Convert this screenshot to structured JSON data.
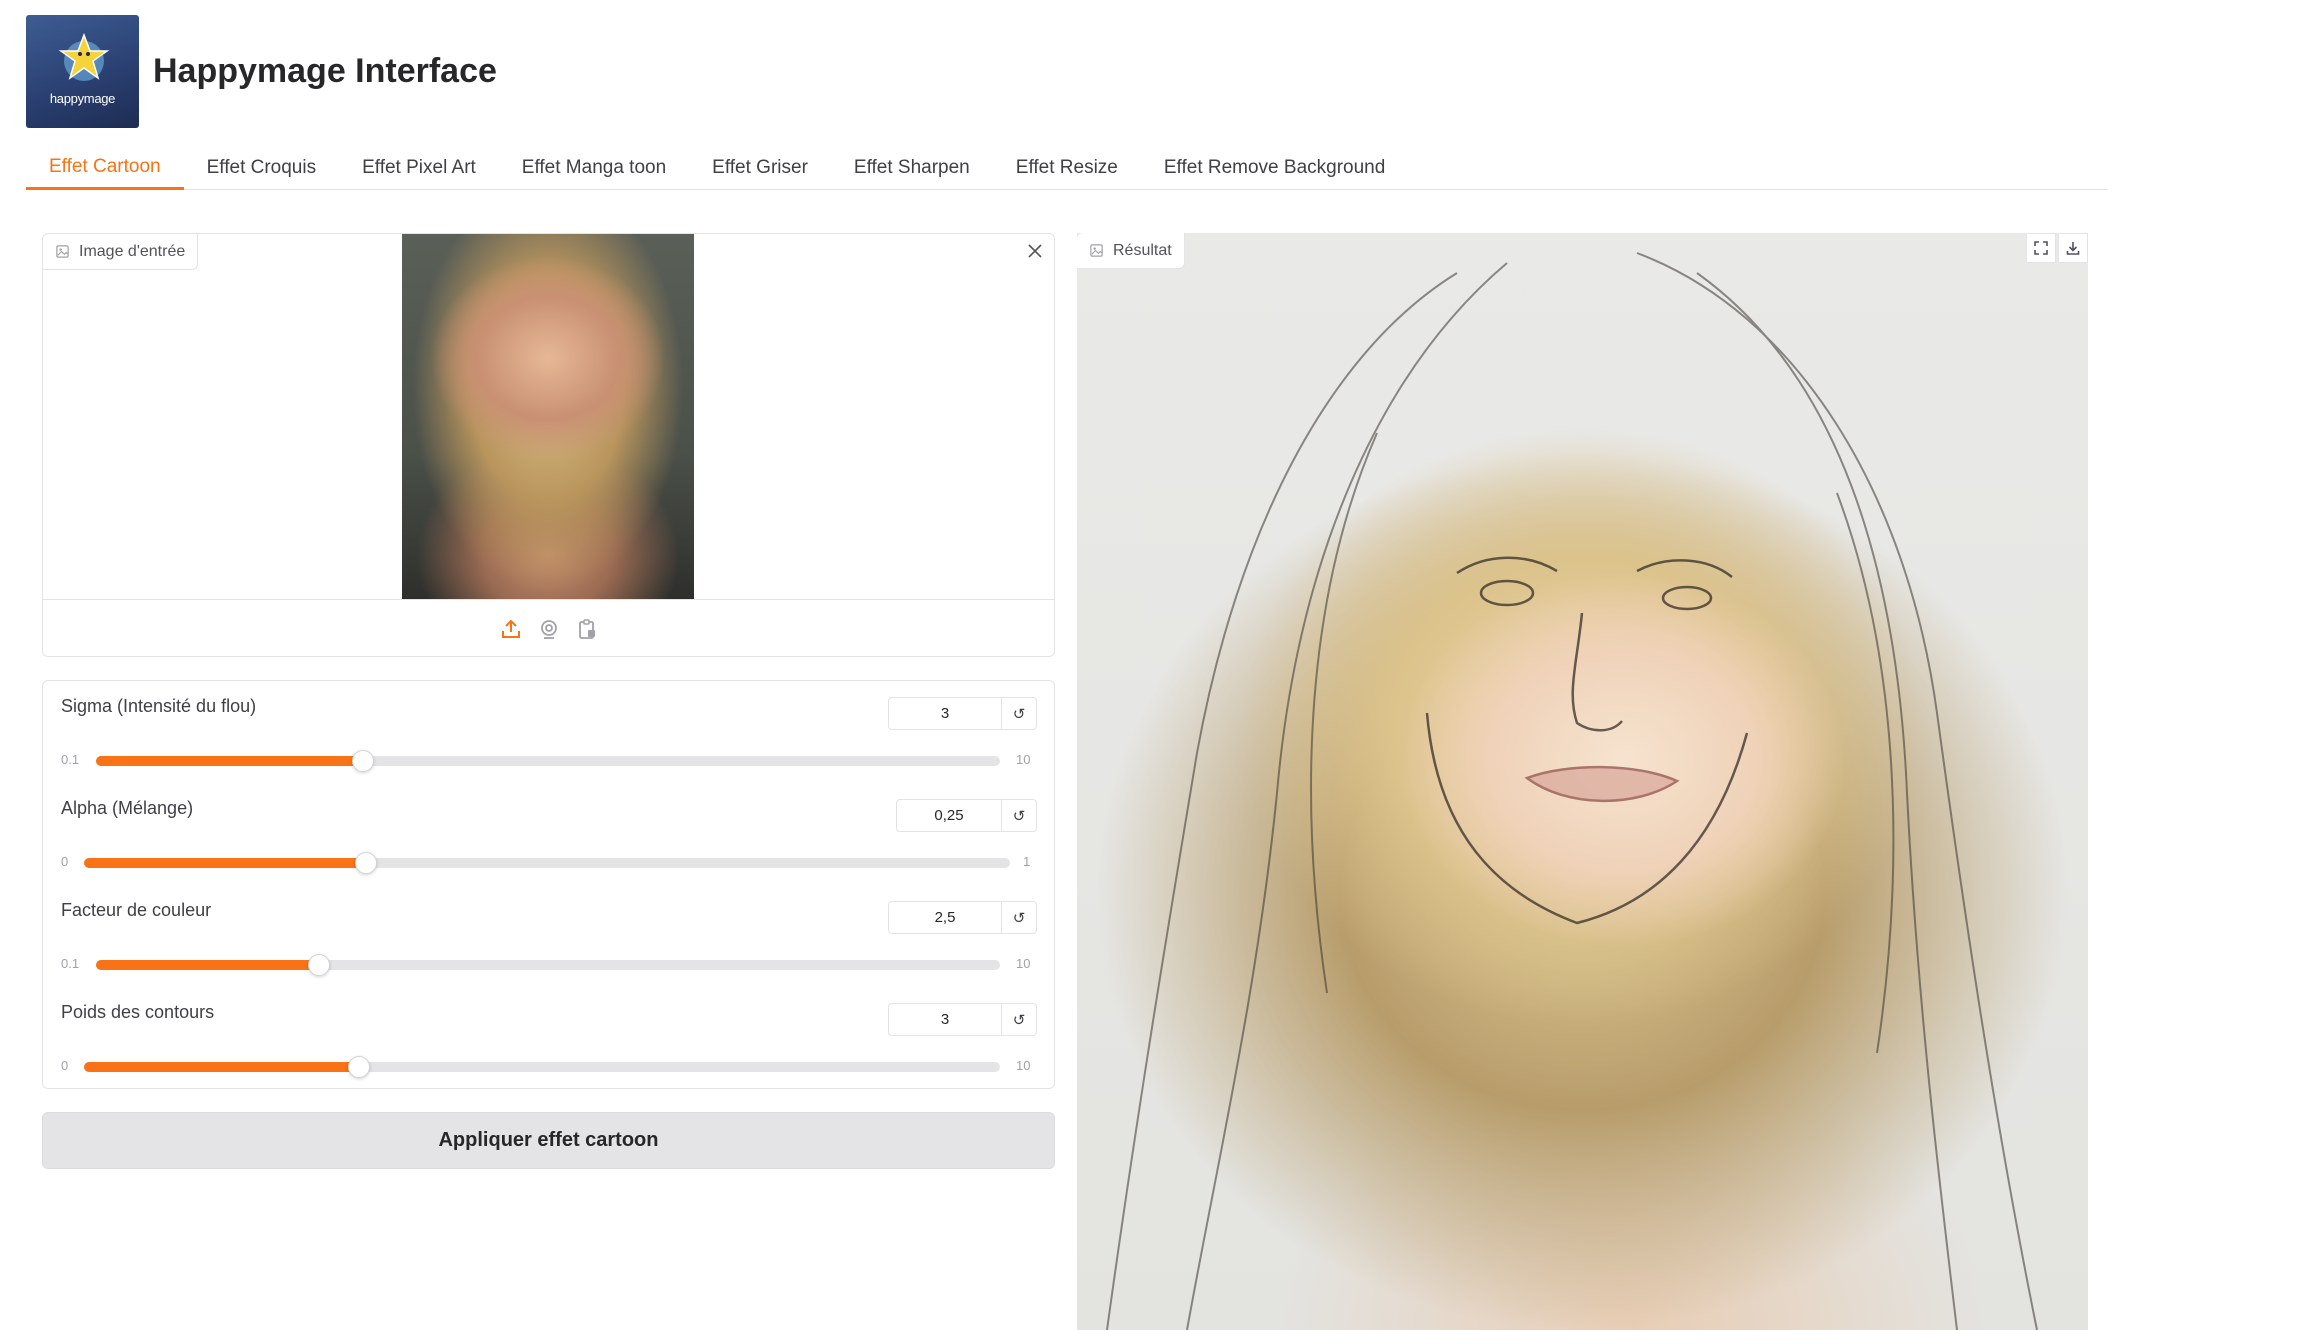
{
  "header": {
    "logo_text": "happymage",
    "title": "Happymage Interface"
  },
  "tabs": [
    {
      "label": "Effet Cartoon",
      "active": true
    },
    {
      "label": "Effet Croquis",
      "active": false
    },
    {
      "label": "Effet Pixel Art",
      "active": false
    },
    {
      "label": "Effet Manga toon",
      "active": false
    },
    {
      "label": "Effet Griser",
      "active": false
    },
    {
      "label": "Effet Sharpen",
      "active": false
    },
    {
      "label": "Effet Resize",
      "active": false
    },
    {
      "label": "Effet Remove Background",
      "active": false
    }
  ],
  "input_image": {
    "label": "Image d'entrée",
    "icons": [
      "image-icon",
      "close-icon",
      "upload-icon",
      "webcam-icon",
      "clipboard-icon"
    ]
  },
  "sliders": [
    {
      "label": "Sigma (Intensité du flou)",
      "value": "3",
      "min": "0.1",
      "max": "10",
      "fraction": 0.295
    },
    {
      "label": "Alpha (Mélange)",
      "value": "0,25",
      "min": "0",
      "max": "1",
      "fraction": 0.305
    },
    {
      "label": "Facteur de couleur",
      "value": "2,5",
      "min": "0.1",
      "max": "10",
      "fraction": 0.247
    },
    {
      "label": "Poids des contours",
      "value": "3",
      "min": "0",
      "max": "10",
      "fraction": 0.3
    }
  ],
  "reset_symbol": "↺",
  "apply_button": {
    "label": "Appliquer effet cartoon"
  },
  "result": {
    "label": "Résultat",
    "icons": [
      "fullscreen-icon",
      "download-icon"
    ]
  },
  "colors": {
    "accent": "#f97316",
    "border": "#e4e4e7",
    "text": "#27272a",
    "button_bg": "#e4e4e7"
  }
}
